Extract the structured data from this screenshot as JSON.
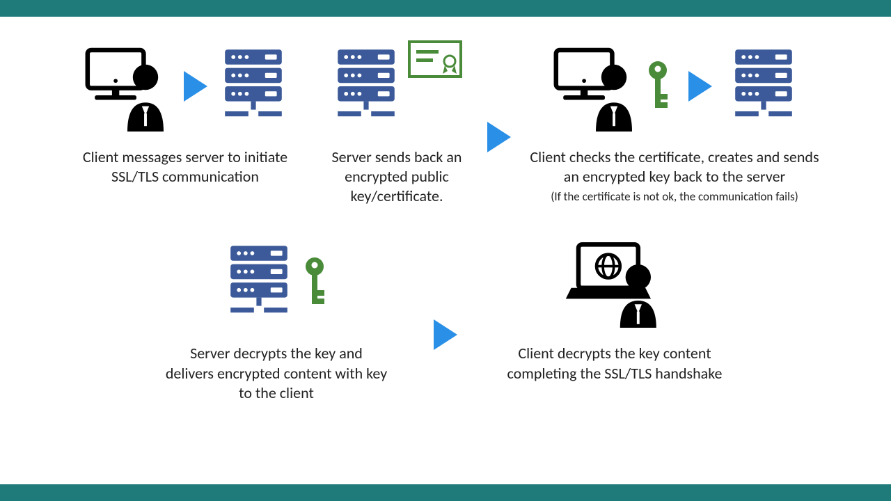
{
  "colors": {
    "bar": "#1f7a7a",
    "arrow": "#2a8fe6",
    "server": "#3c5a99",
    "key": "#4a8b3a",
    "cert": "#4a8b3a",
    "client": "#000000"
  },
  "steps": {
    "s1": {
      "caption": "Client messages server to initiate SSL/TLS communication"
    },
    "s2": {
      "caption": "Server sends back an encrypted public key/certificate."
    },
    "s3": {
      "caption": "Client checks the certificate, creates and sends an encrypted key back to the server",
      "sub": "(If the certificate is not ok, the communication fails)"
    },
    "s4": {
      "caption": "Server decrypts the key and delivers encrypted content with key to the client"
    },
    "s5": {
      "caption": "Client decrypts the key content completing the SSL/TLS handshake"
    }
  }
}
